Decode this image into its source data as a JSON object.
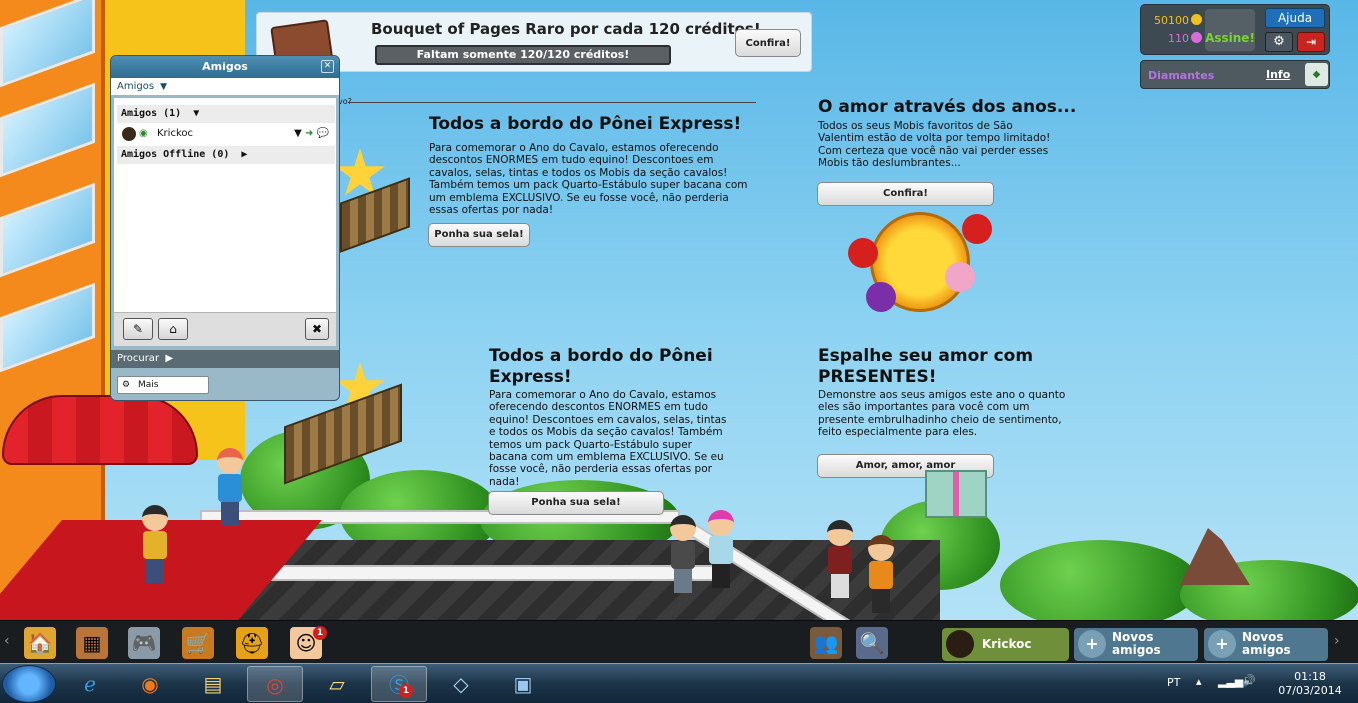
{
  "promo": {
    "title": "Bouquet of Pages Raro por cada 120 créditos!",
    "progress_text": "Faltam somente 120/120 créditos!",
    "progress_fraction": 1.0,
    "button_label": "Confira!"
  },
  "hud": {
    "coins": "50100",
    "gems": "110",
    "subscribe_label": "Assine!",
    "help_label": "Ajuda",
    "coin_color": "#f0c020",
    "gem_color": "#d86cd8",
    "accent_color": "#7bd232"
  },
  "diamonds": {
    "label": "Diamantes",
    "info_label": "Info"
  },
  "catalog": {
    "cut_label": "vo?",
    "news": [
      {
        "title": "Todos a bordo do Pônei Express!",
        "text": "Para comemorar o Ano do Cavalo, estamos oferecendo descontos ENORMES em tudo equino! Descontoes em cavalos, selas, tintas e todos os Mobis da seção cavalos! Também temos um pack Quarto-Estábulo super bacana com um emblema EXCLUSIVO. Se eu fosse você, não perderia essas ofertas por nada!",
        "button": "Ponha sua sela!"
      },
      {
        "title": "O amor através dos anos...",
        "text": "Todos os seus Mobis favoritos de São Valentim estão de volta por tempo limitado! Com certeza que você não vai perder esses Mobis tão deslumbrantes...",
        "button": "Confira!"
      },
      {
        "title": "Todos a bordo do Pônei Express!",
        "text": "Para comemorar o Ano do Cavalo, estamos oferecendo descontos ENORMES em tudo equino! Descontoes em cavalos, selas, tintas e todos os Mobis da seção cavalos! Também temos um pack Quarto-Estábulo super bacana com um emblema EXCLUSIVO. Se eu fosse você, não perderia essas ofertas por nada!",
        "button": "Ponha sua sela!"
      },
      {
        "title": "Espalhe seu amor com PRESENTES!",
        "text": "Demonstre aos seus amigos este ano o quanto eles são importantes para você com um presente embrulhadinho cheio de sentimento, feito especialmente para eles.",
        "button": "Amor, amor, amor"
      }
    ]
  },
  "friends_window": {
    "title": "Amigos",
    "tab_label": "Amigos",
    "online_category": "Amigos (1)",
    "friends": [
      {
        "name": "Krickoc"
      }
    ],
    "offline_category": "Amigos Offline (0)",
    "search_label": "Procurar",
    "more_label": "Mais",
    "close_symbol": "✕"
  },
  "gamebar": {
    "notification_count": "1",
    "friend_slots": [
      {
        "label": "Krickoc",
        "icon": "avatar-icon",
        "color": "#6f8f3a"
      },
      {
        "label": "Novos amigos",
        "icon": "add-friend-icon",
        "color": "#4f7890"
      },
      {
        "label": "Novos amigos",
        "icon": "add-friend-icon",
        "color": "#4f7890"
      }
    ]
  },
  "taskbar": {
    "apps": [
      {
        "name": "internet-explorer-icon",
        "active": false
      },
      {
        "name": "firefox-icon",
        "active": false
      },
      {
        "name": "explorer-icon",
        "active": false
      },
      {
        "name": "chrome-icon",
        "active": true
      },
      {
        "name": "notes-icon",
        "active": false
      },
      {
        "name": "skype-icon",
        "active": true
      },
      {
        "name": "window-icon",
        "active": false
      },
      {
        "name": "remote-desktop-icon",
        "active": false
      }
    ],
    "skype_badge": "1",
    "language": "PT",
    "time": "01:18",
    "date": "07/03/2014"
  }
}
